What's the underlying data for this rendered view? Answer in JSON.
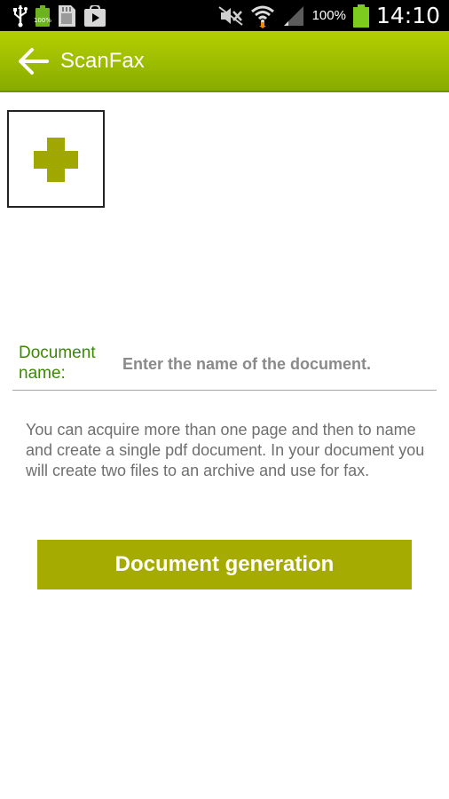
{
  "status_bar": {
    "battery_small_label": "100%",
    "battery_percent": "100%",
    "time": "14:10",
    "icons": [
      "usb-icon",
      "battery-icon",
      "sd-card-icon",
      "play-store-icon",
      "mute-icon",
      "wifi-icon",
      "signal-icon",
      "battery-icon"
    ]
  },
  "action_bar": {
    "title": "ScanFax",
    "back_icon": "arrow-left-icon",
    "color": "#9cbc00"
  },
  "add_page": {
    "icon": "plus-icon",
    "color": "#a0a800"
  },
  "document": {
    "label": "Document name:",
    "placeholder": "Enter the name of the document.",
    "value": ""
  },
  "info": {
    "text": "You can acquire more than one page and then to name and create a single pdf document. In your document you will create two files to an archive and use for fax."
  },
  "generate_button": {
    "label": "Document generation",
    "color": "#a5ab00"
  }
}
